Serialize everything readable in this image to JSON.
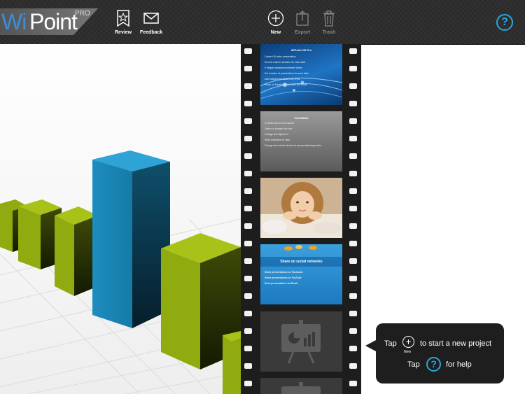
{
  "app": {
    "logo_wi": "Wi",
    "logo_point": "Point",
    "logo_pro": "PRO"
  },
  "toolbar": {
    "review": "Review",
    "feedback": "Feedback",
    "new": "New",
    "export": "Export",
    "trash": "Trash",
    "help": "?"
  },
  "slides": {
    "s1": {
      "title": "WiPoint HD Pro",
      "lines": [
        "Create HD video presentation",
        "Record custom narration for each slide",
        "5 elegant transitions between slides",
        "Set duration of presentation for each slide",
        "Add background music from iPod",
        "Share on Facebook, YouTube and Email"
      ]
    },
    "s2": {
      "title": "Text Editor",
      "lines": [
        "10 fonts and 10 font colours",
        "Option to change font size",
        "Change text alignment",
        "Write anywhere on slide",
        "Change size of text window to accomodate large texts"
      ]
    },
    "s4": {
      "title": "Share on social networks",
      "lines": [
        "Share presentations on Facebook",
        "Share presentations on YouTube",
        "Send presentations via Email"
      ]
    }
  },
  "callout": {
    "tap1": "Tap",
    "new_label": "New",
    "text1": "to start a new project",
    "tap2": "Tap",
    "help_glyph": "?",
    "text2": "for help"
  },
  "colors": {
    "accent": "#2aa7e0",
    "bar_blue": "#1a8ab8",
    "bar_green": "#8fab10"
  }
}
